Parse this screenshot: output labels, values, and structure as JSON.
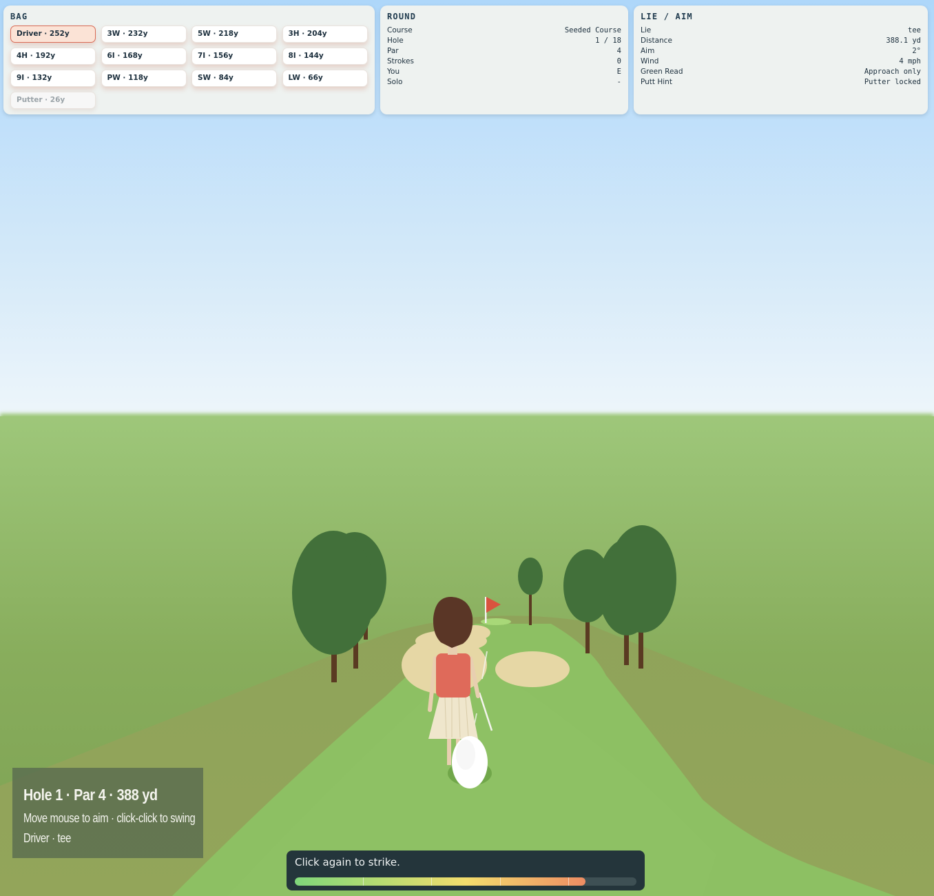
{
  "bag": {
    "title": "BAG",
    "clubs": [
      {
        "label": "Driver · 252y",
        "state": "selected"
      },
      {
        "label": "3W · 232y",
        "state": "normal"
      },
      {
        "label": "5W · 218y",
        "state": "normal"
      },
      {
        "label": "3H · 204y",
        "state": "normal"
      },
      {
        "label": "4H · 192y",
        "state": "normal"
      },
      {
        "label": "6I · 168y",
        "state": "normal"
      },
      {
        "label": "7I · 156y",
        "state": "normal"
      },
      {
        "label": "8I · 144y",
        "state": "normal"
      },
      {
        "label": "9I · 132y",
        "state": "normal"
      },
      {
        "label": "PW · 118y",
        "state": "normal"
      },
      {
        "label": "SW · 84y",
        "state": "normal"
      },
      {
        "label": "LW · 66y",
        "state": "normal"
      },
      {
        "label": "Putter · 26y",
        "state": "disabled"
      }
    ]
  },
  "round": {
    "title": "ROUND",
    "rows": [
      {
        "label": "Course",
        "value": "Seeded Course"
      },
      {
        "label": "Hole",
        "value": "1 / 18"
      },
      {
        "label": "Par",
        "value": "4"
      },
      {
        "label": "Strokes",
        "value": "0"
      },
      {
        "label": "You",
        "value": "E"
      },
      {
        "label": "Solo",
        "value": "-"
      }
    ]
  },
  "lie": {
    "title": "LIE / AIM",
    "rows": [
      {
        "label": "Lie",
        "value": "tee"
      },
      {
        "label": "Distance",
        "value": "388.1 yd"
      },
      {
        "label": "Aim",
        "value": "2°"
      },
      {
        "label": "Wind",
        "value": "4 mph"
      },
      {
        "label": "Green Read",
        "value": "Approach only"
      },
      {
        "label": "Putt Hint",
        "value": "Putter locked"
      }
    ]
  },
  "hud": {
    "title": "Hole 1 · Par 4 · 388 yd",
    "hint": "Move mouse to aim · click-click to swing",
    "status": "Driver · tee"
  },
  "swing": {
    "message": "Click again to strike.",
    "power": 0.85,
    "meter_ticks": [
      0.2,
      0.4,
      0.6,
      0.8
    ]
  },
  "colors": {
    "sky_top": "#aed7fa",
    "sky_bottom": "#e9f4fb",
    "ground": "#8fa35a",
    "fairway": "#8dc063",
    "sand": "#e6d7a5",
    "tree": "#42703a",
    "flag": "#d9533f",
    "selected_club": "#fbe3d6"
  }
}
